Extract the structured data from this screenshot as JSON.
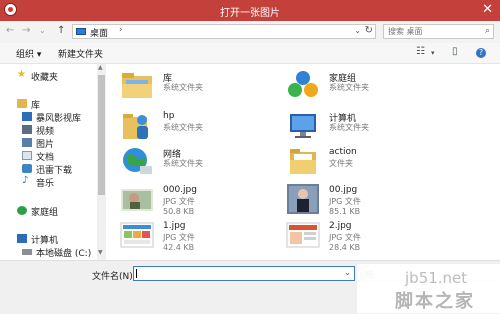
{
  "window": {
    "title": "打开一张图片",
    "close_glyph": "✕"
  },
  "nav": {
    "back": "←",
    "forward": "→",
    "dropdown": "⌄",
    "up": "↑",
    "address": {
      "current": "桌面",
      "separator": "›",
      "refresh": "↻"
    },
    "search": {
      "placeholder": "搜索 桌面",
      "icon": "search-icon"
    }
  },
  "toolbar": {
    "organize": "组织 ▾",
    "new_folder": "新建文件夹",
    "view": "☷",
    "view_dropdown": "▾",
    "pane": "▯",
    "help": "?"
  },
  "sidebar": {
    "items": [
      {
        "label": "收藏夹",
        "icon": "star-icon",
        "color": "#f2b51c"
      },
      {
        "label": "库",
        "icon": "library-icon",
        "color": "#e1b64c"
      },
      {
        "label": "暴风影视库",
        "icon": "video-library-icon",
        "color": "#2c6fb9"
      },
      {
        "label": "视频",
        "icon": "video-icon",
        "color": "#5b6d84"
      },
      {
        "label": "图片",
        "icon": "pictures-icon",
        "color": "#5a7fa6"
      },
      {
        "label": "文档",
        "icon": "documents-icon",
        "color": "#8696ab"
      },
      {
        "label": "迅雷下载",
        "icon": "thunder-icon",
        "color": "#3e83c6"
      },
      {
        "label": "音乐",
        "icon": "music-icon",
        "color": "#3c6cb0"
      },
      {
        "label": "家庭组",
        "icon": "homegroup-icon",
        "color": "#2aa148"
      },
      {
        "label": "计算机",
        "icon": "computer-icon",
        "color": "#2d6cb6"
      },
      {
        "label": "本地磁盘 (C:)",
        "icon": "drive-icon",
        "color": "#8a8f96"
      }
    ]
  },
  "files": [
    {
      "name": "库",
      "meta": [
        "系统文件夹"
      ],
      "icon": "library-folder-icon"
    },
    {
      "name": "家庭组",
      "meta": [
        "系统文件夹"
      ],
      "icon": "homegroup-icon"
    },
    {
      "name": "hp",
      "meta": [
        "系统文件夹"
      ],
      "icon": "user-folder-icon"
    },
    {
      "name": "计算机",
      "meta": [
        "系统文件夹"
      ],
      "icon": "computer-icon"
    },
    {
      "name": "网络",
      "meta": [
        "系统文件夹"
      ],
      "icon": "network-icon"
    },
    {
      "name": "action",
      "meta": [
        "文件夹"
      ],
      "icon": "folder-icon"
    },
    {
      "name": "000.jpg",
      "meta": [
        "JPG 文件",
        "50.8 KB"
      ],
      "icon": "jpg-thumbnail-icon"
    },
    {
      "name": "00.jpg",
      "meta": [
        "JPG 文件",
        "85.1 KB"
      ],
      "icon": "jpg-thumbnail-icon"
    },
    {
      "name": "1.jpg",
      "meta": [
        "JPG 文件",
        "42.4 KB"
      ],
      "icon": "jpg-thumbnail-icon"
    },
    {
      "name": "2.jpg",
      "meta": [
        "JPG 文件",
        "28.4 KB"
      ],
      "icon": "jpg-thumbnail-icon"
    }
  ],
  "bottom": {
    "filename_label": "文件名(N):",
    "filename_value": "",
    "filetype": "所"
  },
  "watermark": {
    "line1": "jb51.net",
    "line2": "脚本之家"
  },
  "colors": {
    "title_bar": "#c4403b",
    "accent": "#3c7fb1"
  }
}
